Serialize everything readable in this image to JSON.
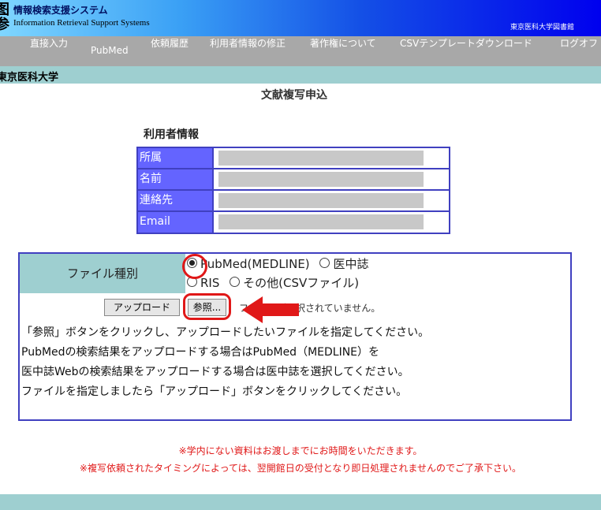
{
  "header": {
    "logo_glyph": "图\n参",
    "title_ja": "情報検索支援システム",
    "title_en": "Information Retrieval Support Systems",
    "org": "東京医科大学図書館"
  },
  "nav": {
    "items": [
      {
        "label": "直接入力"
      },
      {
        "label": "PubMed"
      },
      {
        "label": "依頼履歴"
      },
      {
        "label": "利用者情報の修正"
      },
      {
        "label": "著作権について"
      },
      {
        "label": "CSVテンプレートダウンロード"
      },
      {
        "label": "ログオフ"
      }
    ]
  },
  "institution": {
    "name": "東京医科大学"
  },
  "page": {
    "title": "文献複写申込"
  },
  "user_info": {
    "heading": "利用者情報",
    "rows": [
      {
        "label": "所属"
      },
      {
        "label": "名前"
      },
      {
        "label": "連絡先"
      },
      {
        "label": "Email"
      }
    ]
  },
  "upload": {
    "file_type_label": "ファイル種別",
    "options": [
      {
        "label": "PubMed(MEDLINE)",
        "checked": true
      },
      {
        "label": "医中誌",
        "checked": false
      },
      {
        "label": "RIS",
        "checked": false
      },
      {
        "label": "その他(CSVファイル)",
        "checked": false
      }
    ],
    "upload_button": "アップロード",
    "browse_button": "参照...",
    "no_file_text": "ファイルが選択されていません。",
    "instructions": [
      "「参照」ボタンをクリックし、アップロードしたいファイルを指定してください。",
      "PubMedの検索結果をアップロードする場合はPubMed（MEDLINE）を",
      "医中誌Webの検索結果をアップロードする場合は医中誌を選択してください。",
      "ファイルを指定しましたら「アップロード」ボタンをクリックしてください。"
    ]
  },
  "notices": [
    "※学内にない資料はお渡しまでにお時間をいただきます。",
    "※複写依頼されたタイミングによっては、翌開館日の受付となり即日処理されませんのでご了承下さい。"
  ],
  "colors": {
    "accent_red": "#e01818",
    "table_blue": "#6464ff",
    "teal_bar": "#9ecfd0"
  }
}
